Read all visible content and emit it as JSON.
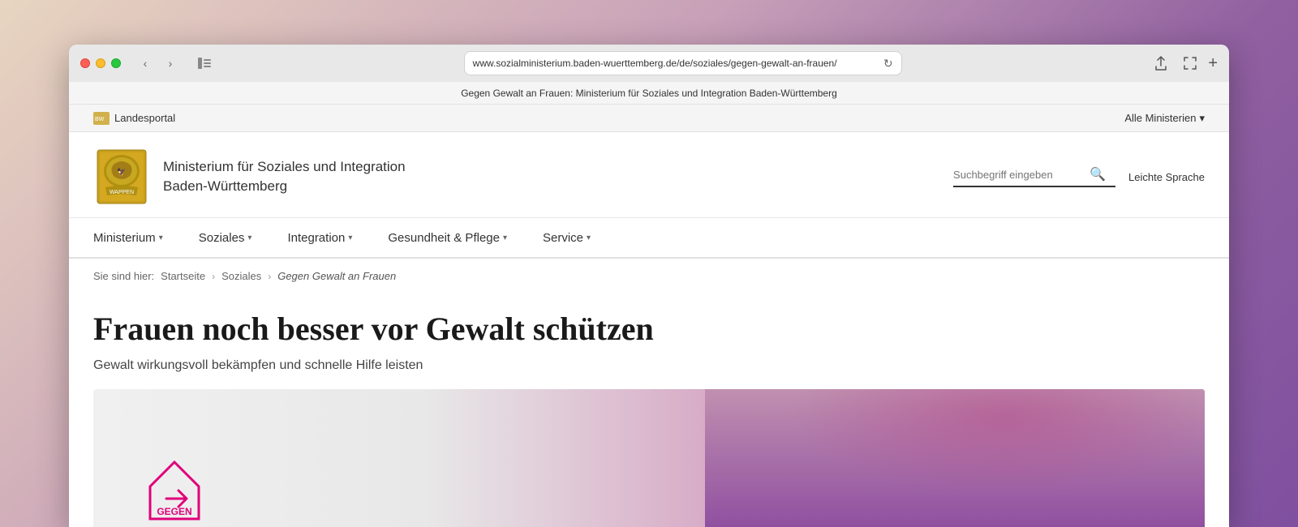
{
  "browser": {
    "url": "www.sozialministerium.baden-wuerttemberg.de/de/soziales/gegen-gewalt-an-frauen/",
    "tab_title": "Gegen Gewalt an Frauen: Ministerium für Soziales und Integration Baden-Württemberg"
  },
  "top_bar": {
    "landesportal_label": "Landesportal",
    "alle_ministerien_label": "Alle Ministerien",
    "chevron": "▾"
  },
  "header": {
    "ministry_line1": "Ministerium für Soziales und Integration",
    "ministry_line2": "Baden-Württemberg",
    "search_placeholder": "Suchbegriff eingeben",
    "leichte_sprache": "Leichte Sprache"
  },
  "nav": {
    "items": [
      {
        "label": "Ministerium",
        "chevron": "▾"
      },
      {
        "label": "Soziales",
        "chevron": "▾"
      },
      {
        "label": "Integration",
        "chevron": "▾"
      },
      {
        "label": "Gesundheit & Pflege",
        "chevron": "▾"
      },
      {
        "label": "Service",
        "chevron": "▾"
      }
    ]
  },
  "breadcrumb": {
    "prefix": "Sie sind hier:",
    "items": [
      {
        "label": "Startseite",
        "link": true
      },
      {
        "label": "Soziales",
        "link": true
      },
      {
        "label": "Gegen Gewalt an Frauen",
        "link": false,
        "current": true
      }
    ]
  },
  "page": {
    "title": "Frauen noch besser vor Gewalt schützen",
    "subtitle": "Gewalt wirkungsvoll bekämpfen und schnelle Hilfe leisten"
  },
  "hero": {
    "gegen_text": "GEGEN"
  }
}
